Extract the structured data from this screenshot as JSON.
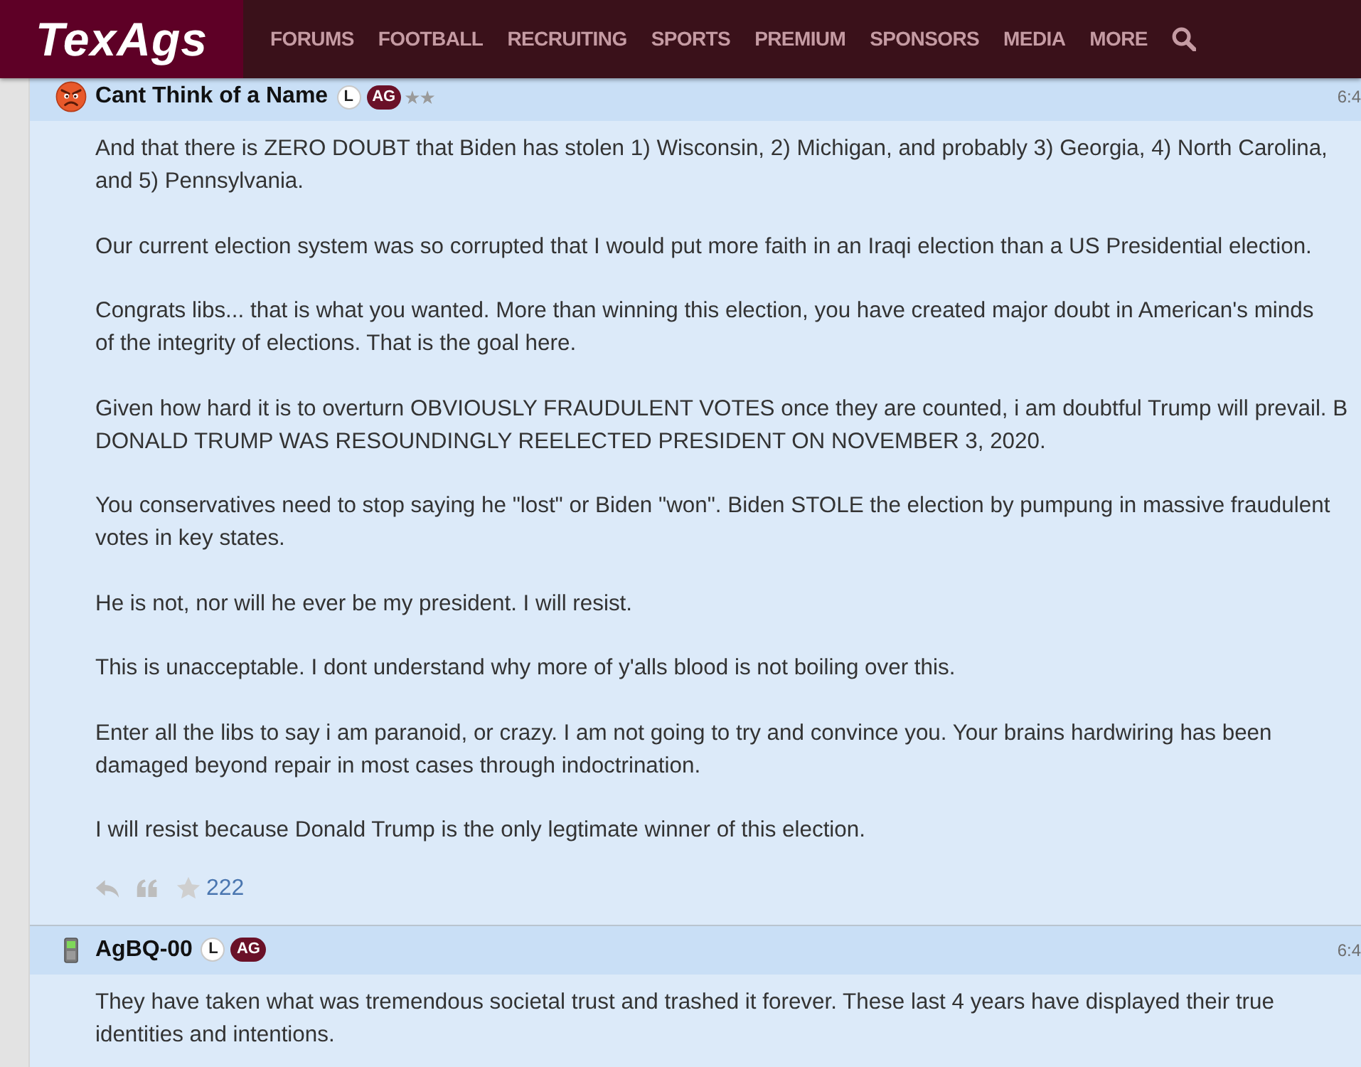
{
  "nav": {
    "logo": "TexAgs",
    "items": [
      "FORUMS",
      "FOOTBALL",
      "RECRUITING",
      "SPORTS",
      "PREMIUM",
      "SPONSORS",
      "MEDIA",
      "MORE"
    ]
  },
  "posts": [
    {
      "avatar": {
        "kind": "emoji"
      },
      "author": "Cant Think of a Name",
      "badges": [
        {
          "kind": "outline",
          "text": "L"
        },
        {
          "kind": "filled",
          "text": "AG"
        },
        {
          "kind": "rank",
          "text": "★★"
        }
      ],
      "time": "6:4",
      "paragraphs": [
        [
          "And that there is ZERO DOUBT that Biden has stolen 1) Wisconsin, 2) Michigan, and probably 3) Georgia, 4) North Carolina,",
          "and 5) Pennsylvania."
        ],
        [
          "Our current election system was so corrupted that I would put more faith in an Iraqi election than a US Presidential election."
        ],
        [
          "Congrats libs... that is what you wanted. More than winning this election, you have created major doubt in American's minds",
          "of the integrity of elections. That is the goal here."
        ],
        [
          "Given how hard it is to overturn OBVIOUSLY FRAUDULENT VOTES once they are counted, i am doubtful Trump will prevail. B",
          "DONALD TRUMP WAS RESOUNDINGLY REELECTED PRESIDENT ON NOVEMBER 3, 2020."
        ],
        [
          "You conservatives need to stop saying he \"lost\" or Biden \"won\". Biden STOLE the election by pumpung in massive fraudulent",
          "votes in key states."
        ],
        [
          "He is not, nor will he ever be my president. I will resist."
        ],
        [
          "This is unacceptable. I dont understand why more of y'alls blood is not boiling over this."
        ],
        [
          "Enter all the libs to say i am paranoid, or crazy. I am not going to try and convince you. Your brains hardwiring has been",
          "damaged beyond repair in most cases through indoctrination."
        ],
        [
          "I will resist because Donald Trump is the only legtimate winner of this election."
        ]
      ],
      "actions": {
        "star_count": "222"
      }
    },
    {
      "avatar": {
        "kind": "device"
      },
      "author": "AgBQ-00",
      "badges": [
        {
          "kind": "outline",
          "text": "L"
        },
        {
          "kind": "filled",
          "text": "AG"
        }
      ],
      "time": "6:4",
      "paragraphs": [
        [
          "They have taken what was tremendous societal trust and trashed it forever. These last 4 years have displayed their true",
          "identities and intentions."
        ]
      ]
    }
  ]
}
